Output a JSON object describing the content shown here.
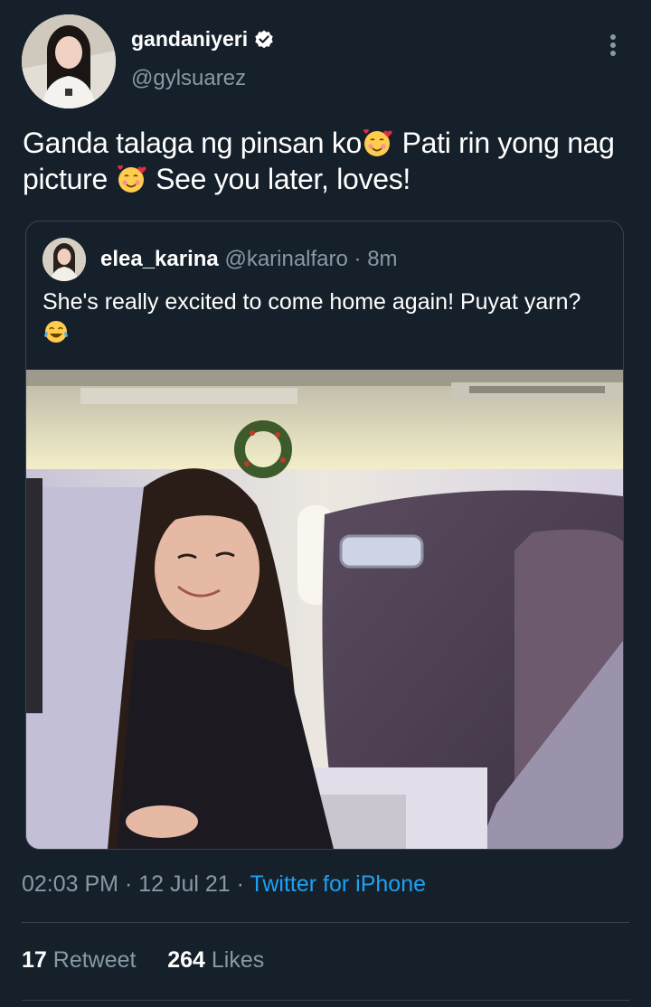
{
  "tweet": {
    "display_name": "gandaniyeri",
    "handle": "@gylsuarez",
    "text_part1": "Ganda talaga ng pinsan ko",
    "text_part2": " Pati rin yong nag picture ",
    "text_part3": " See you later, loves!",
    "emoji": "smiling-face-with-hearts"
  },
  "quoted": {
    "display_name": "elea_karina",
    "handle": "@karinalfaro",
    "separator": " · ",
    "time": "8m",
    "text": "She's really excited to come home again! Puyat yarn?",
    "emoji": "face-with-tears-of-joy"
  },
  "meta": {
    "time": "02:03 PM",
    "sep1": " · ",
    "date": "12 Jul 21",
    "sep2": " · ",
    "source": "Twitter for iPhone"
  },
  "stats": {
    "retweets": "17",
    "retweet_label": "Retweet",
    "likes": "264",
    "likes_label": "Likes"
  },
  "colors": {
    "background": "#15202b",
    "accent": "#1da1f2",
    "secondary_text": "#8899a6",
    "border": "#38444d"
  }
}
